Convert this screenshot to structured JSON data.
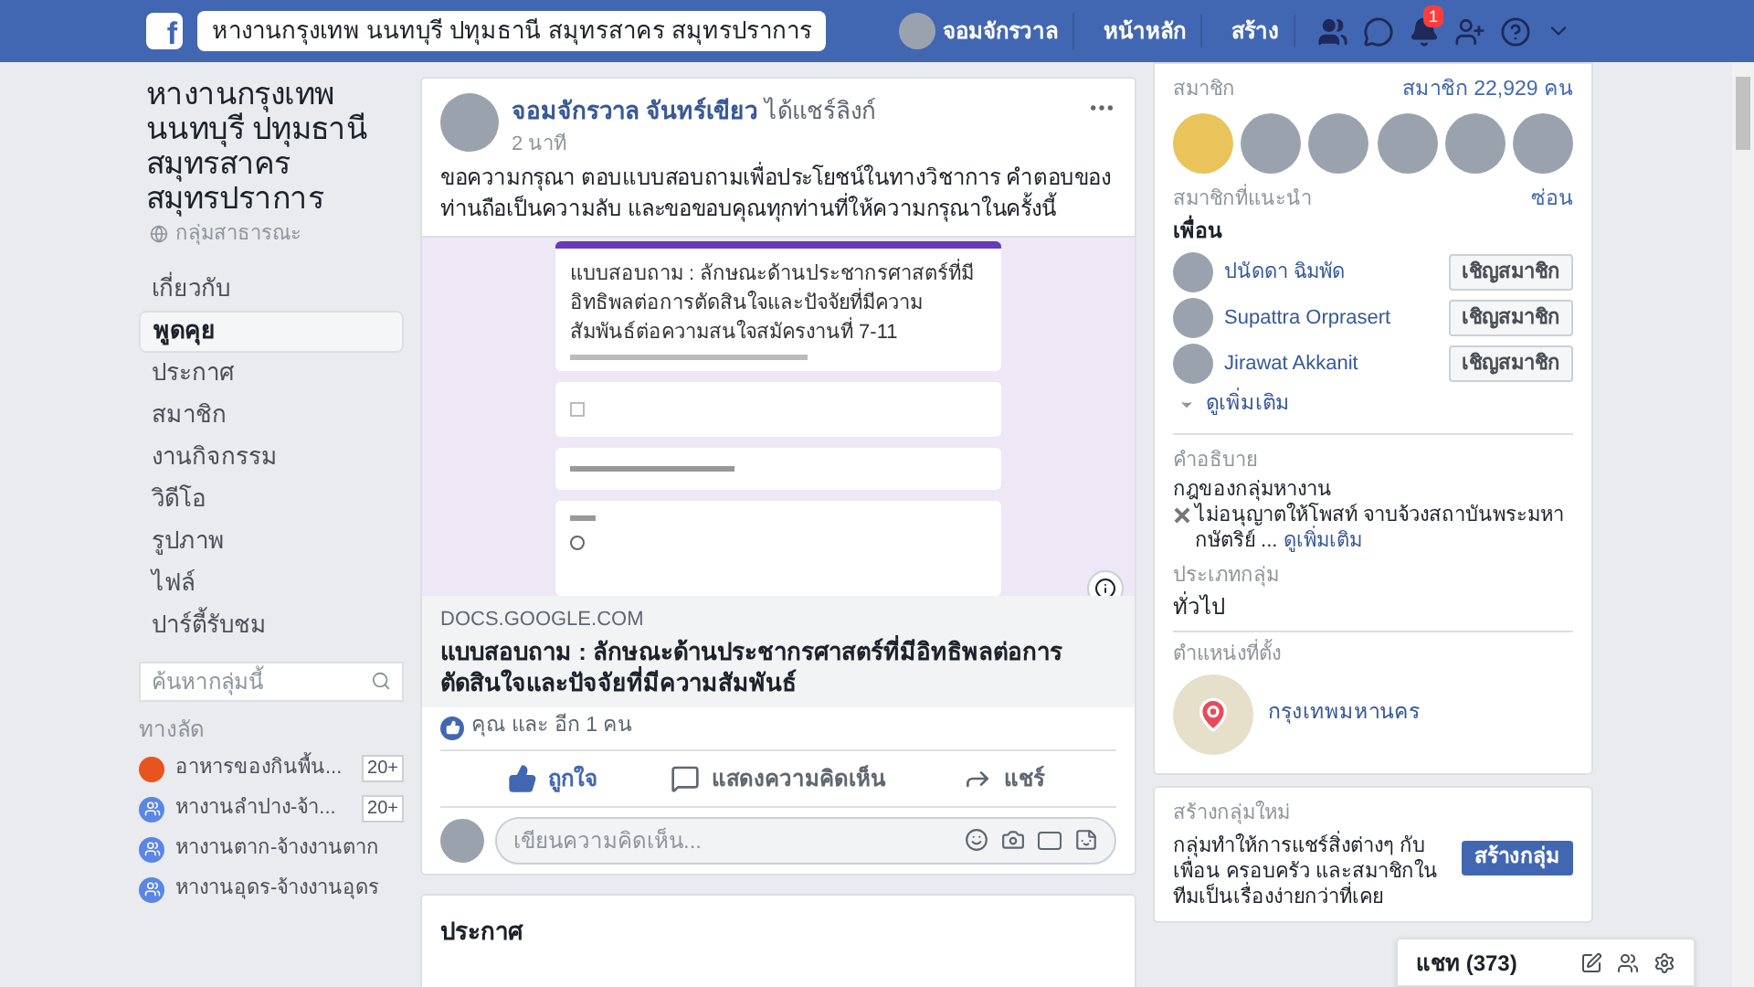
{
  "topbar": {
    "logo": "f",
    "search_value": "หางานกรุงเทพ นนทบุรี ปทุมธานี สมุทรสาคร สมุทรปราการ",
    "user_name": "จอมจักรวาล",
    "nav": [
      "หน้าหลัก",
      "สร้าง"
    ],
    "notification_count": "1"
  },
  "group": {
    "name": "หางานกรุงเทพ นนทบุรี ปทุมธานี สมุทรสาคร สมุทรปราการ",
    "privacy": "กลุ่มสาธารณะ",
    "nav": [
      {
        "label": "เกี่ยวกับ",
        "selected": false
      },
      {
        "label": "พูดคุย",
        "selected": true
      },
      {
        "label": "ประกาศ",
        "selected": false
      },
      {
        "label": "สมาชิก",
        "selected": false
      },
      {
        "label": "งานกิจกรรม",
        "selected": false
      },
      {
        "label": "วิดีโอ",
        "selected": false
      },
      {
        "label": "รูปภาพ",
        "selected": false
      },
      {
        "label": "ไฟล์",
        "selected": false
      },
      {
        "label": "ปาร์ตี้รับชม",
        "selected": false
      }
    ],
    "search_placeholder": "ค้นหากลุ่มนี้",
    "shortcuts_title": "ทางลัด",
    "shortcuts": [
      {
        "kind": "food",
        "name": "อาหารของกินพื้น...",
        "badge": "20+"
      },
      {
        "kind": "group",
        "name": "หางานลำปาง-จ้า...",
        "badge": "20+"
      },
      {
        "kind": "group",
        "name": "หางานตาก-จ้างงานตาก"
      },
      {
        "kind": "group",
        "name": "หางานอุดร-จ้างงานอุดร"
      }
    ]
  },
  "post": {
    "author": "จอมจักรวาล จันทร์เขียว",
    "action": "ได้แชร์ลิงก์",
    "time": "2 นาที",
    "text": "ขอความกรุณา ตอบแบบสอบถามเพื่อประโยชน์ในทางวิชาการ คำตอบของท่านถือเป็นความลับ และขอขอบคุณทุกท่านที่ให้ความกรุณาในครั้งนี้",
    "preview": {
      "checkbox_checked": false,
      "radio_selected": false,
      "form_title": "แบบสอบถาม : ลักษณะด้านประชากรศาสตร์ที่มีอิทธิพลต่อการตัดสินใจและปัจจัยที่มีความสัมพันธ์ต่อความสนใจสมัครงานที่ 7-11",
      "domain": "DOCS.GOOGLE.COM",
      "title": "แบบสอบถาม : ลักษณะด้านประชากรศาสตร์ที่มีอิทธิพลต่อการตัดสินใจและปัจจัยที่มีความสัมพันธ์"
    },
    "reactions": "คุณ และ อีก 1 คน",
    "actions": [
      {
        "kind": "like",
        "label": "ถูกใจ"
      },
      {
        "kind": "comment",
        "label": "แสดงความคิดเห็น"
      },
      {
        "kind": "share",
        "label": "แชร์"
      }
    ],
    "comment_placeholder": "เขียนความคิดเห็น..."
  },
  "announcements_title": "ประกาศ",
  "sidebar": {
    "members_title": "สมาชิก",
    "members_count": "สมาชิก 22,929 คน",
    "suggested_title": "สมาชิกที่แนะนำ",
    "hide_link": "ซ่อน",
    "friends_label": "เพื่อน",
    "suggestions": [
      {
        "name": "ปนัดดา ฉิมพัด",
        "button": "เชิญสมาชิก"
      },
      {
        "name": "Supattra Orprasert",
        "button": "เชิญสมาชิก"
      },
      {
        "name": "Jirawat Akkanit",
        "button": "เชิญสมาชิก"
      }
    ],
    "see_more": "ดูเพิ่มเติม",
    "description_label": "คำอธิบาย",
    "description_title": "กฎของกลุ่มหางาน",
    "description_text": "ไม่อนุญาตให้โพสท์ จาบจ้วงสถาบันพระมหากษัตริย์ ...",
    "description_more": "ดูเพิ่มเติม",
    "type_label": "ประเภทกลุ่ม",
    "type_value": "ทั่วไป",
    "location_label": "ตำแหน่งที่ตั้ง",
    "location": "กรุงเทพมหานคร",
    "create_title": "สร้างกลุ่มใหม่",
    "create_text": "กลุ่มทำให้การแชร์สิ่งต่างๆ กับเพื่อน ครอบครัว และสมาชิกในทีมเป็นเรื่องง่ายกว่าที่เคย",
    "create_button": "สร้างกลุ่ม"
  },
  "chat": {
    "label": "แชท (373)"
  }
}
